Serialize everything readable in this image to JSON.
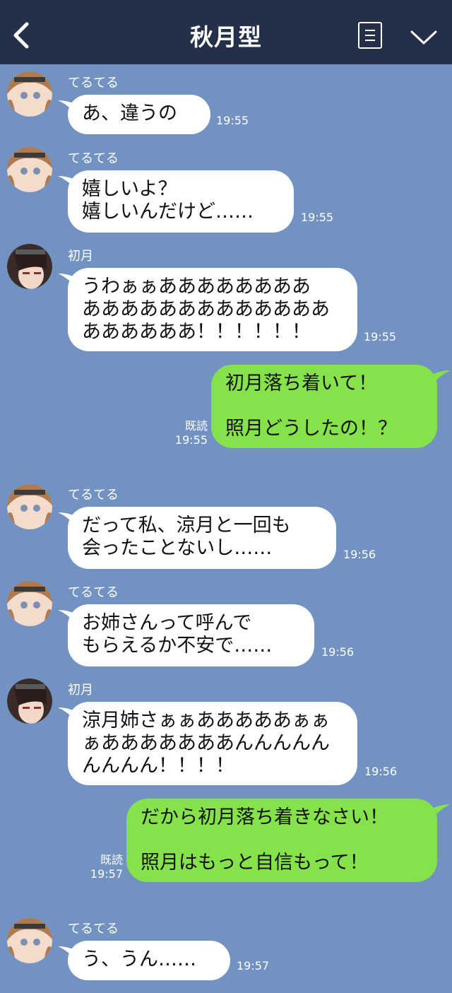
{
  "header": {
    "title": "秋月型"
  },
  "messages": [
    {
      "sender": "てるてる",
      "text": "あ、違うの",
      "time": "19:55"
    },
    {
      "sender": "てるてる",
      "text": "嬉しいよ？\n嬉しいんだけど……",
      "time": "19:55"
    },
    {
      "sender": "初月",
      "text": "うわぁぁああああああああ\nあああああああああああああ\nああああああ！！！！！！",
      "time": "19:55"
    },
    {
      "out": true,
      "text": "初月落ち着いて！\n\n照月どうしたの！？",
      "read": "既読",
      "time": "19:55"
    },
    {
      "sender": "てるてる",
      "text": "だって私、涼月と一回も\n会ったことないし……",
      "time": "19:56"
    },
    {
      "sender": "てるてる",
      "text": "お姉さんって呼んで\nもらえるか不安で……",
      "time": "19:56"
    },
    {
      "sender": "初月",
      "text": "涼月姉さぁぁあああああぁぁ\nぁあああああああんんんんん\nんんんん！！！！",
      "time": "19:56"
    },
    {
      "out": true,
      "text": "だから初月落ち着きなさい！\n\n照月はもっと自信もって！",
      "read": "既読",
      "time": "19:57"
    },
    {
      "sender": "てるてる",
      "text": "う、うん……",
      "time": "19:57"
    }
  ]
}
